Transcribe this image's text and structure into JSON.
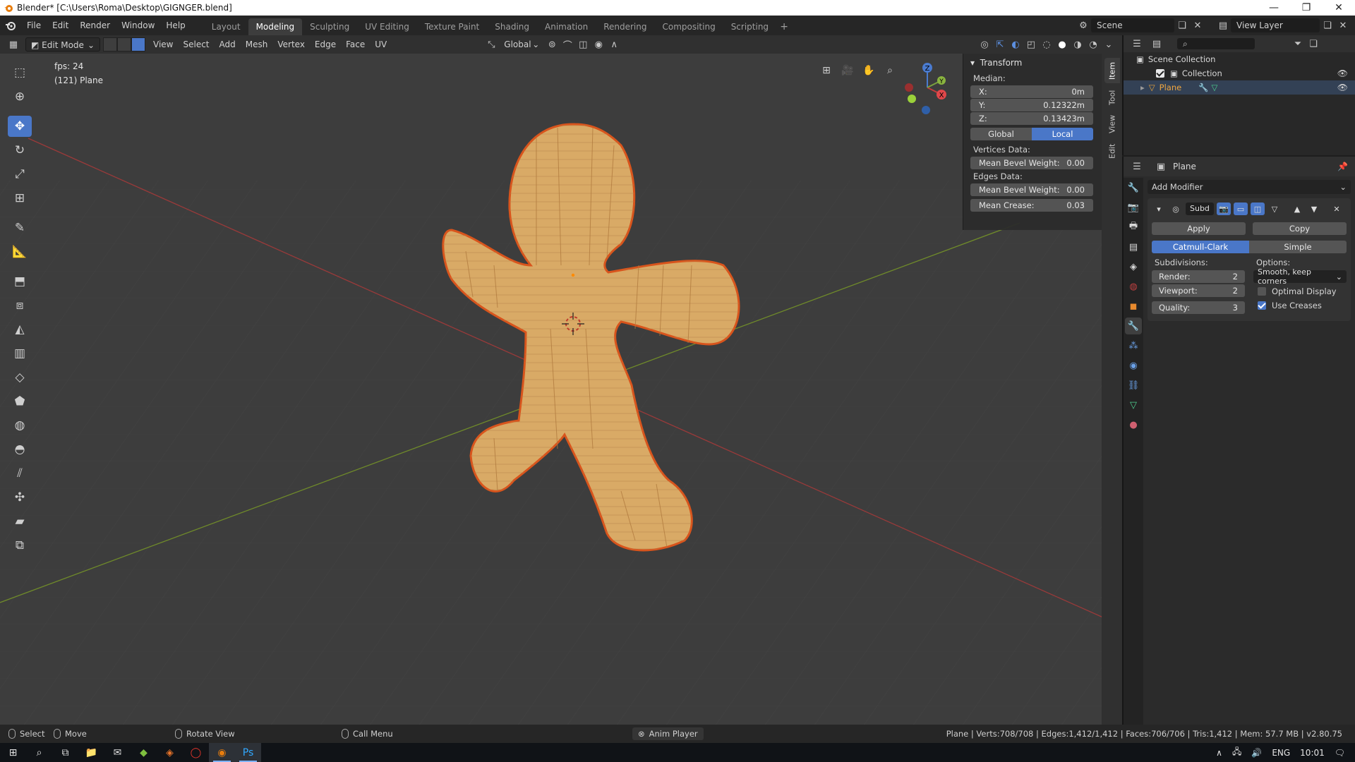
{
  "window": {
    "title": "Blender* [C:\\Users\\Roma\\Desktop\\GIGNGER.blend]",
    "controls": [
      "—",
      "❐",
      "✕"
    ]
  },
  "topbar": {
    "menus": [
      "File",
      "Edit",
      "Render",
      "Window",
      "Help"
    ],
    "workspaces": [
      "Layout",
      "Modeling",
      "Sculpting",
      "UV Editing",
      "Texture Paint",
      "Shading",
      "Animation",
      "Rendering",
      "Compositing",
      "Scripting"
    ],
    "active_workspace": "Modeling",
    "add_workspace": "+",
    "scene": "Scene",
    "view_layer": "View Layer"
  },
  "vp_header": {
    "mode": "Edit Mode",
    "menus": [
      "View",
      "Select",
      "Add",
      "Mesh",
      "Vertex",
      "Edge",
      "Face",
      "UV"
    ],
    "orientation": "Global"
  },
  "viewport": {
    "fps": "fps: 24",
    "object_info": "(121) Plane"
  },
  "npanel": {
    "title": "Transform",
    "median_label": "Median:",
    "x_label": "X:",
    "x_value": "0m",
    "y_label": "Y:",
    "y_value": "0.12322m",
    "z_label": "Z:",
    "z_value": "0.13423m",
    "space_global": "Global",
    "space_local": "Local",
    "space_active": "Local",
    "vertices_label": "Vertices Data:",
    "vert_bevel_label": "Mean Bevel Weight:",
    "vert_bevel_value": "0.00",
    "edges_label": "Edges Data:",
    "edge_bevel_label": "Mean Bevel Weight:",
    "edge_bevel_value": "0.00",
    "crease_label": "Mean Crease:",
    "crease_value": "0.03",
    "tabs": [
      "Item",
      "Tool",
      "View",
      "Edit"
    ],
    "active_tab": "Item"
  },
  "outliner": {
    "scene_collection": "Scene Collection",
    "collection": "Collection",
    "object": "Plane"
  },
  "properties": {
    "object_name": "Plane",
    "add_modifier": "Add Modifier",
    "modifier_name": "Subd",
    "apply": "Apply",
    "copy": "Copy",
    "catmull": "Catmull-Clark",
    "simple": "Simple",
    "subdivisions_label": "Subdivisions:",
    "render_label": "Render:",
    "render_value": "2",
    "viewport_label": "Viewport:",
    "viewport_value": "2",
    "quality_label": "Quality:",
    "quality_value": "3",
    "options_label": "Options:",
    "uv_smooth": "Smooth, keep corners",
    "optimal_display": "Optimal Display",
    "optimal_display_checked": false,
    "use_creases": "Use Creases",
    "use_creases_checked": true
  },
  "statusbar": {
    "select": "Select",
    "move": "Move",
    "rotate_view": "Rotate View",
    "call_menu": "Call Menu",
    "anim_player": "Anim Player",
    "stats": "Plane | Verts:708/708 | Edges:1,412/1,412 | Faces:706/706 | Tris:1,412 | Mem: 57.7 MB | v2.80.75"
  },
  "taskbar": {
    "language": "ENG",
    "time": "10:01"
  },
  "colors": {
    "accent": "#4a77c8",
    "mesh_fill": "#d9aa66",
    "mesh_edge": "#d8541c",
    "axis_x": "#9a3a3a",
    "axis_y": "#6f8a2a"
  }
}
